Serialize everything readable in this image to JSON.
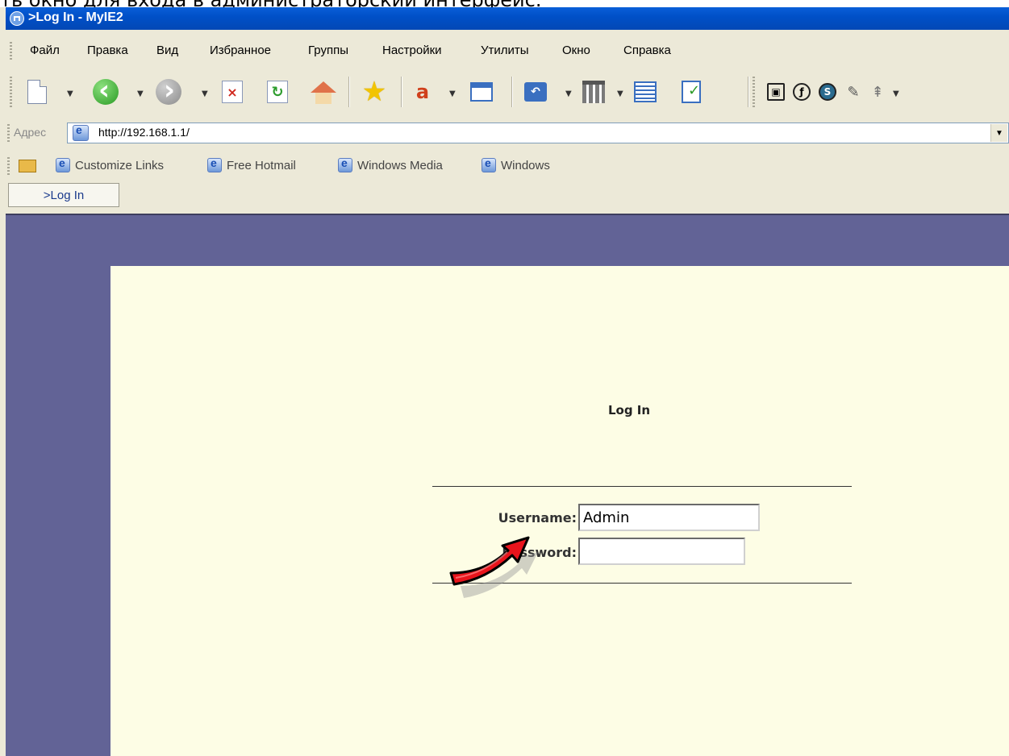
{
  "caption": "ть окно для входа в администраторский интерфейс.",
  "window": {
    "title": ">Log In - MyIE2"
  },
  "menu": [
    "Файл",
    "Правка",
    "Вид",
    "Избранное",
    "Группы",
    "Настройки",
    "Утилиты",
    "Окно",
    "Справка"
  ],
  "toolbar": {
    "icons": [
      "new-page-icon",
      "back-icon",
      "forward-icon",
      "stop-icon",
      "refresh-icon",
      "home-icon",
      "favorites-star-icon",
      "font-size-icon",
      "new-window-icon",
      "undo-close-icon",
      "tools-icon",
      "list-icon",
      "edit-icon",
      "screenshot-icon",
      "flash-icon",
      "shockwave-icon",
      "link-icon",
      "collapse-icon"
    ]
  },
  "address": {
    "label": "Адрес",
    "value": "http://192.168.1.1/"
  },
  "links": [
    "Customize Links",
    "Free Hotmail",
    "Windows Media",
    "Windows"
  ],
  "tab": {
    "label": ">Log In"
  },
  "login": {
    "title": "Log In",
    "username_label": "Username:",
    "username_value": "Admin",
    "password_label": "Password:",
    "password_value": ""
  },
  "colors": {
    "titlebar": "#0050c8",
    "page_bg": "#626396",
    "panel_bg": "#fdfde5",
    "arrow": "#e8141c"
  }
}
